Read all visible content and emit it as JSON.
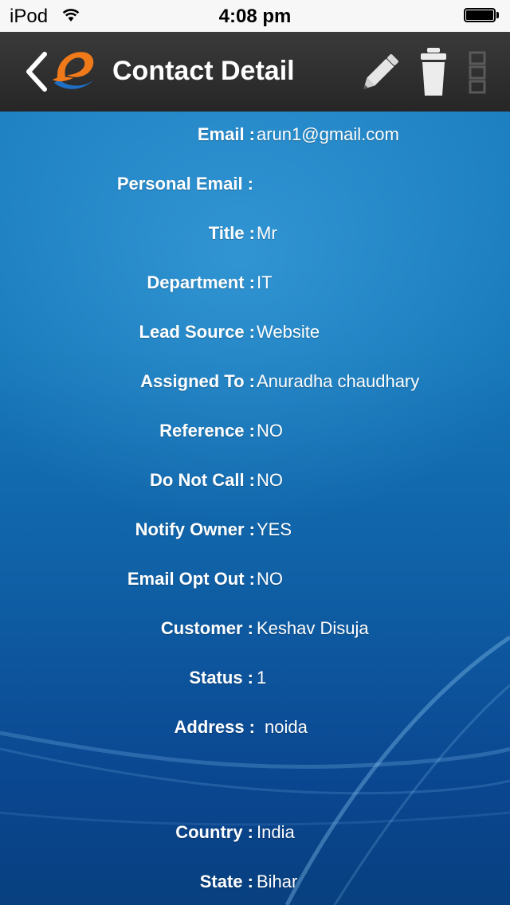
{
  "status_bar": {
    "carrier": "iPod",
    "time": "4:08 pm"
  },
  "nav": {
    "title": "Contact Detail",
    "back_icon": "chevron-left-icon",
    "logo_icon": "app-logo",
    "edit_icon": "pencil-icon",
    "delete_icon": "trash-icon",
    "menu_icon": "more-menu-icon"
  },
  "fields": [
    {
      "label": "Email :",
      "value": "arun1@gmail.com"
    },
    {
      "label": "Personal Email :",
      "value": ""
    },
    {
      "label": "Title :",
      "value": "Mr"
    },
    {
      "label": "Department :",
      "value": "IT"
    },
    {
      "label": "Lead Source :",
      "value": "Website"
    },
    {
      "label": "Assigned To :",
      "value": "Anuradha chaudhary"
    },
    {
      "label": "Reference :",
      "value": "NO"
    },
    {
      "label": "Do Not Call :",
      "value": "NO"
    },
    {
      "label": "Notify Owner :",
      "value": "YES"
    },
    {
      "label": "Email Opt Out :",
      "value": "NO"
    },
    {
      "label": "Customer :",
      "value": "Keshav Disuja"
    },
    {
      "label": "Status :",
      "value": "1"
    },
    {
      "label": "Address :",
      "value": " noida"
    },
    {
      "label": "Country :",
      "value": "India"
    },
    {
      "label": "State :",
      "value": "Bihar"
    }
  ]
}
